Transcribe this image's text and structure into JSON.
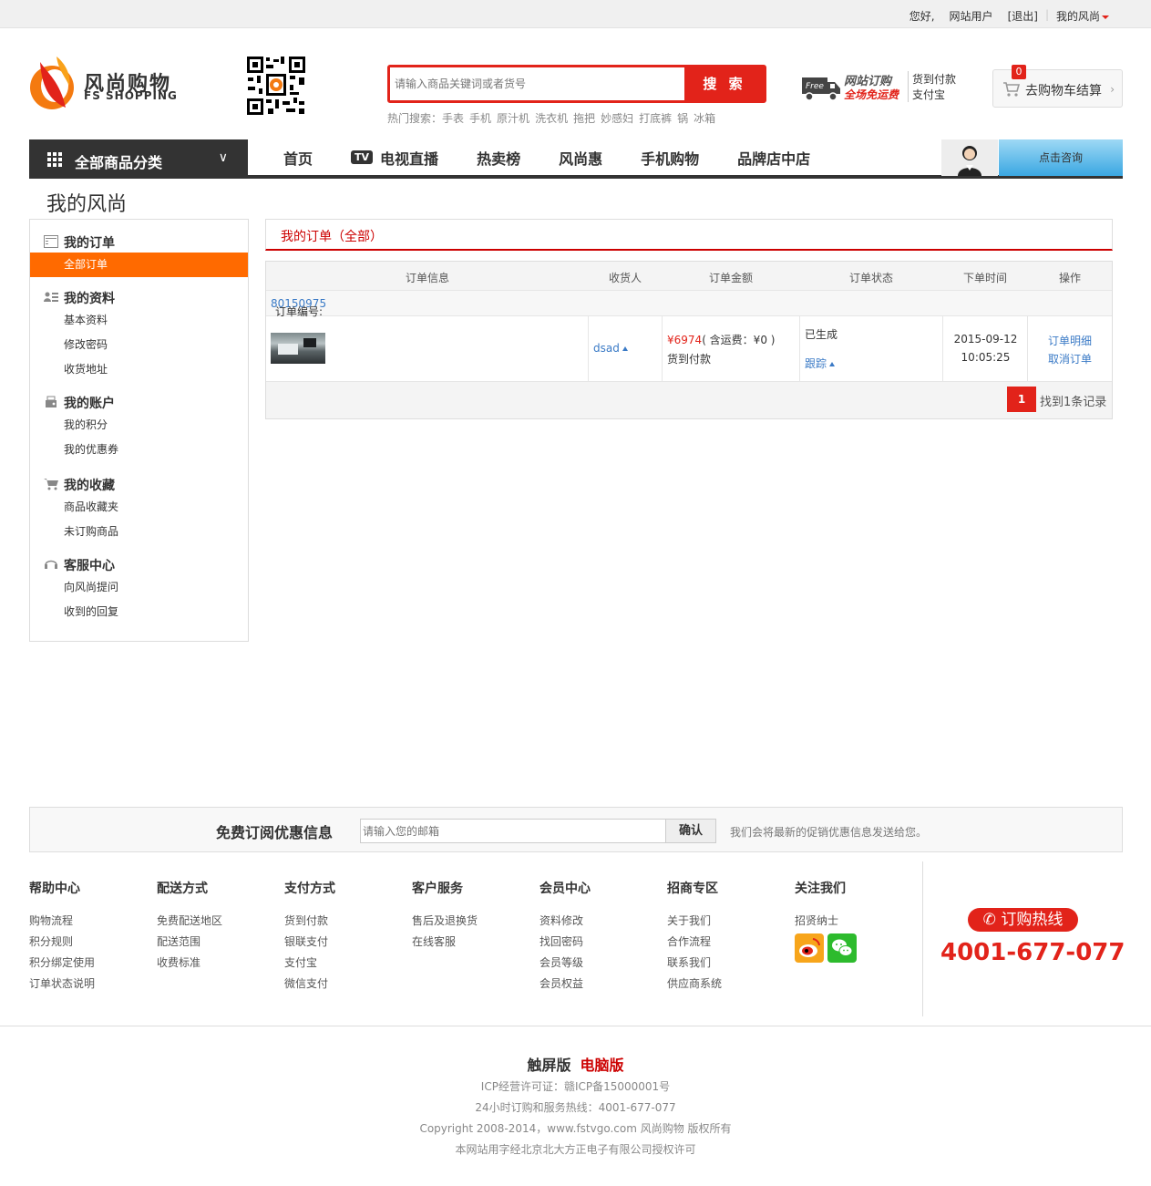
{
  "topbar": {
    "greeting": "您好,",
    "username": "网站用户",
    "logout": "[退出]",
    "my_account": "我的风尚"
  },
  "logo": {
    "cn": "风尚购物",
    "en": "FS SHOPPING"
  },
  "search": {
    "placeholder": "请输入商品关键词或者货号",
    "button": "搜 索",
    "hot_label": "热门搜索：",
    "hot_terms": [
      "手表",
      "手机",
      "原汁机",
      "洗衣机",
      "拖把",
      "妙感妇",
      "打底裤",
      "锅",
      "冰箱"
    ]
  },
  "promo": {
    "free_badge": "Free",
    "line1": "网站订购",
    "line2": "全场免运费",
    "right1": "货到付款",
    "right2": "支付宝"
  },
  "cart": {
    "count": "0",
    "label": "去购物车结算"
  },
  "nav": {
    "all_categories": "全部商品分类",
    "tv_badge": "TV",
    "items": [
      "首页",
      "电视直播",
      "热卖榜",
      "风尚惠",
      "手机购物",
      "品牌店中店"
    ],
    "consult": "点击咨询"
  },
  "page_title": "我的风尚",
  "sidebar": {
    "groups": [
      {
        "title": "我的订单",
        "icon": "order-list-icon",
        "items": [
          "全部订单"
        ]
      },
      {
        "title": "我的资料",
        "icon": "profile-icon",
        "items": [
          "基本资料",
          "修改密码",
          "收货地址"
        ]
      },
      {
        "title": "我的账户",
        "icon": "account-icon",
        "items": [
          "我的积分",
          "我的优惠券"
        ]
      },
      {
        "title": "我的收藏",
        "icon": "cart-icon",
        "items": [
          "商品收藏夹",
          "未订购商品"
        ]
      },
      {
        "title": "客服中心",
        "icon": "headset-icon",
        "items": [
          "向风尚提问",
          "收到的回复"
        ]
      }
    ],
    "active_item": "全部订单"
  },
  "orders": {
    "title": "我的订单（全部）",
    "columns": [
      "订单信息",
      "收货人",
      "订单金额",
      "订单状态",
      "下单时间",
      "操作"
    ],
    "order_no_label": "订单编号:",
    "order_no": "80150975",
    "row": {
      "receiver": "dsad",
      "amount": "¥6974",
      "shipping": "( 含运费：¥0 )",
      "pay_method": "货到付款",
      "status": "已生成",
      "track": "跟踪",
      "date": "2015-09-12",
      "time": "10:05:25",
      "action_detail": "订单明细",
      "action_cancel": "取消订单"
    },
    "pager": {
      "current_page": "1",
      "summary": "找到1条记录"
    }
  },
  "subscribe": {
    "title": "免费订阅优惠信息",
    "placeholder": "请输入您的邮箱",
    "button": "确认",
    "note": "我们会将最新的促销优惠信息发送给您。"
  },
  "footer": {
    "columns": [
      {
        "title": "帮助中心",
        "items": [
          "购物流程",
          "积分规则",
          "积分绑定使用",
          "订单状态说明"
        ]
      },
      {
        "title": "配送方式",
        "items": [
          "免费配送地区",
          "配送范围",
          "收费标准"
        ]
      },
      {
        "title": "支付方式",
        "items": [
          "货到付款",
          "银联支付",
          "支付宝",
          "微信支付"
        ]
      },
      {
        "title": "客户服务",
        "items": [
          "售后及退换货",
          "在线客服"
        ]
      },
      {
        "title": "会员中心",
        "items": [
          "资料修改",
          "找回密码",
          "会员等级",
          "会员权益"
        ]
      },
      {
        "title": "招商专区",
        "items": [
          "关于我们",
          "合作流程",
          "联系我们",
          "供应商系统"
        ]
      },
      {
        "title": "关注我们",
        "items": [
          "招贤纳士"
        ]
      }
    ],
    "hotline_label": "订购热线",
    "hotline_number": "4001-677-077",
    "mode_touch": "触屏版",
    "mode_pc": "电脑版",
    "icp": "ICP经营许可证：赣ICP备15000001号",
    "service": "24小时订购和服务热线：4001-677-077",
    "copyright": "Copyright 2008-2014，www.fstvgo.com 风尚购物 版权所有",
    "font_license": "本网站用字经北京北大方正电子有限公司授权许可"
  },
  "colors": {
    "brand_red": "#e2231a",
    "active_orange": "#ff6a00",
    "link_blue": "#3a7ac6"
  }
}
